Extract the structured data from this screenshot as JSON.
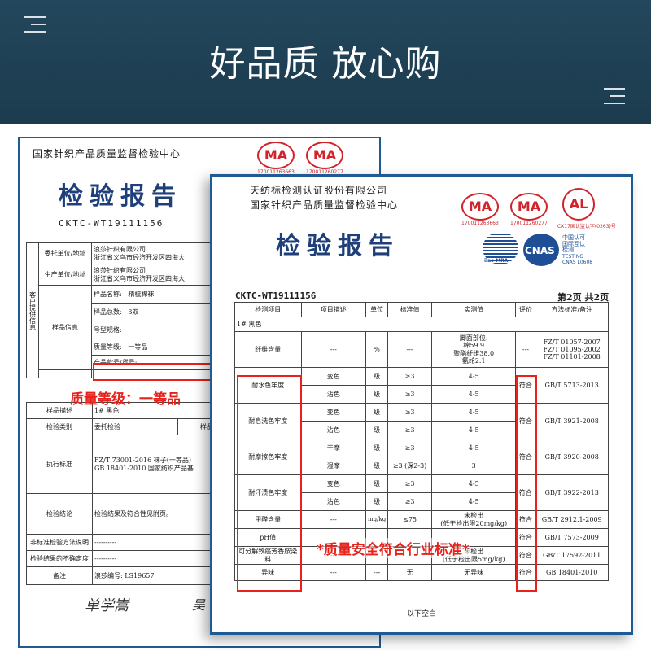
{
  "header": {
    "title": "好品质 放心购"
  },
  "back_report": {
    "org": "国家针织产品质量监督检验中心",
    "title": "检验报告",
    "code": "CKTC-WT19111156",
    "ma_numbers": [
      "170011263663",
      "170011260277"
    ],
    "rows": {
      "client_label": "委托单位/地址",
      "client_name": "浪莎针织有限公司",
      "client_addr": "浙江省义乌市经济开发区四海大",
      "maker_label": "生产单位/地址",
      "maker_name": "浪莎针织有限公司",
      "maker_addr": "浙江省义乌市经济开发区四海大",
      "side_label": "客户提供信息",
      "info_label": "样品信息",
      "name_label": "样品名称:",
      "name_value": "精梳棉袜",
      "total_label": "样品总数:",
      "total_value": "3双",
      "model_label": "号型规格:",
      "grade_label": "质量等级:",
      "grade_value": "一等品",
      "article_label": "产品款号/货号:",
      "desc_label": "样品描述",
      "desc_value": "1# 黑色",
      "type_label": "检验类别",
      "type_value": "委托检验",
      "recv_label": "样品受理日",
      "std_label": "执行标准",
      "std_1": "FZ/T 73001-2016 袜子(一等品)",
      "std_2": "GB 18401-2010 国家纺织产品基",
      "concl_label": "检验结论",
      "concl_value": "检验结果及符合性见附页。",
      "nonstd_label": "非标准检验方法说明",
      "nonstd_value": "----------",
      "uncert_label": "检验结果的不确定度",
      "uncert_value": "----------",
      "remark_label": "备注",
      "remark_value": "浪莎编号: LS19657"
    },
    "signature": "单学嵩",
    "signature2": "吴",
    "annotation": "质量等级：一等品"
  },
  "front_report": {
    "org1": "天纺标检测认证股份有限公司",
    "org2": "国家针织产品质量监督检验中心",
    "title": "检验报告",
    "code": "CKTC-WT19111156",
    "page": "第2页 共2页",
    "ma_numbers": [
      "170011263663",
      "170011260277"
    ],
    "cal_number": "CX17国认监认字(0263)号",
    "cnas_cn": "中国认可\n国际互认\n检测",
    "cnas_en": "TESTING\nCNAS L0608",
    "cnas_logo": "CNAS",
    "ilac_logo": "ilac-MRA",
    "headers": [
      "检测项目",
      "项目描述",
      "单位",
      "标准值",
      "实测值",
      "评价",
      "方法标准/备注"
    ],
    "sample": "1#  黑色",
    "fiber": {
      "label": "纤维含量",
      "desc": "---",
      "unit": "%",
      "std": "---",
      "value": "脚面部位:\n棉59.9\n聚酯纤维38.0\n氨纶2.1",
      "eval": "---",
      "method": "FZ/T 01057-2007\nFZ/T 01095-2002\nFZ/T 01101-2008"
    },
    "groups": [
      {
        "label": "耐水色牢度",
        "method": "GB/T 5713-2013",
        "rows": [
          {
            "desc": "变色",
            "unit": "级",
            "std": "≥3",
            "value": "4-5"
          },
          {
            "desc": "沾色",
            "unit": "级",
            "std": "≥3",
            "value": "4-5"
          }
        ]
      },
      {
        "label": "耐皂洗色牢度",
        "method": "GB/T 3921-2008",
        "rows": [
          {
            "desc": "变色",
            "unit": "级",
            "std": "≥3",
            "value": "4-5"
          },
          {
            "desc": "沾色",
            "unit": "级",
            "std": "≥3",
            "value": "4-5"
          }
        ]
      },
      {
        "label": "耐摩擦色牢度",
        "method": "GB/T 3920-2008",
        "rows": [
          {
            "desc": "干摩",
            "unit": "级",
            "std": "≥3",
            "value": "4-5"
          },
          {
            "desc": "湿摩",
            "unit": "级",
            "std": "≥3 (深2-3)",
            "value": "3"
          }
        ]
      },
      {
        "label": "耐汗渍色牢度",
        "method": "GB/T 3922-2013",
        "rows": [
          {
            "desc": "变色",
            "unit": "级",
            "std": "≥3",
            "value": "4-5"
          },
          {
            "desc": "沾色",
            "unit": "级",
            "std": "≥3",
            "value": "4-5"
          }
        ]
      }
    ],
    "eval_ok": "符合",
    "formaldehyde": {
      "label": "甲醛含量",
      "desc": "---",
      "unit": "mg/kg",
      "std": "≤75",
      "value": "未检出\n(低于检出限20mg/kg)",
      "method": "GB/T 2912.1-2009"
    },
    "ph": {
      "label": "pH值",
      "desc": "",
      "unit": "",
      "std": "",
      "value": "",
      "method": "GB/T 7573-2009"
    },
    "amine": {
      "label": "可分解致癌芳香胺染料",
      "desc": "---",
      "unit": "",
      "std": "",
      "value": "未检出\n(低于检出限5mg/kg)",
      "method": "GB/T 17592-2011"
    },
    "odor": {
      "label": "异味",
      "desc": "---",
      "unit": "---",
      "std": "无",
      "value": "无异味",
      "method": "GB 18401-2010"
    },
    "blank": "以下空白",
    "annotation": "*质量安全符合行业标准*"
  },
  "colors": {
    "header_bg": "#1c3b4e",
    "frame_blue": "#1e5a93",
    "annotation_red": "#e8211b",
    "seal_red": "#d1242a"
  }
}
